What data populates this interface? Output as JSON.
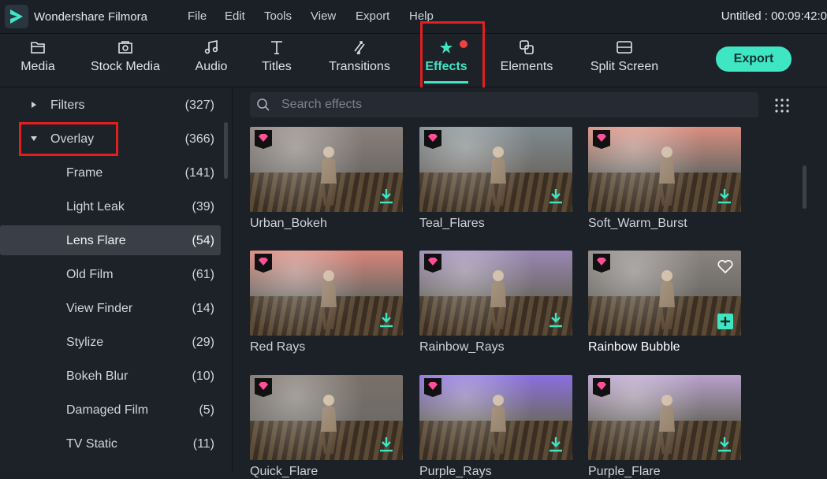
{
  "app": {
    "name": "Wondershare Filmora",
    "project_info": "Untitled : 00:09:42:0"
  },
  "menu": [
    "File",
    "Edit",
    "Tools",
    "View",
    "Export",
    "Help"
  ],
  "toolbar": {
    "tabs": [
      {
        "label": "Media",
        "icon": "folder-icon"
      },
      {
        "label": "Stock Media",
        "icon": "stock-media-icon"
      },
      {
        "label": "Audio",
        "icon": "music-note-icon"
      },
      {
        "label": "Titles",
        "icon": "text-t-icon"
      },
      {
        "label": "Transitions",
        "icon": "transitions-icon"
      },
      {
        "label": "Effects",
        "icon": "effects-star-icon",
        "active": true
      },
      {
        "label": "Elements",
        "icon": "elements-icon"
      },
      {
        "label": "Split Screen",
        "icon": "split-screen-icon"
      }
    ],
    "export_label": "Export",
    "accent_color": "#3ee6c4"
  },
  "sidebar": {
    "categories": [
      {
        "name": "Filters",
        "count": "(327)",
        "expanded": false
      },
      {
        "name": "Overlay",
        "count": "(366)",
        "expanded": true
      },
      {
        "name": "Frame",
        "count": "(141)"
      },
      {
        "name": "Light Leak",
        "count": "(39)"
      },
      {
        "name": "Lens Flare",
        "count": "(54)",
        "selected": true
      },
      {
        "name": "Old Film",
        "count": "(61)"
      },
      {
        "name": "View Finder",
        "count": "(14)"
      },
      {
        "name": "Stylize",
        "count": "(29)"
      },
      {
        "name": "Bokeh Blur",
        "count": "(10)"
      },
      {
        "name": "Damaged Film",
        "count": "(5)"
      },
      {
        "name": "TV Static",
        "count": "(11)"
      }
    ]
  },
  "search": {
    "placeholder": "Search effects"
  },
  "effects": [
    {
      "name": "Urban_Bokeh",
      "tint": "#8a7f7a"
    },
    {
      "name": "Teal_Flares",
      "tint": "#7e8a8e"
    },
    {
      "name": "Soft_Warm_Burst",
      "tint": "#d98d7e"
    },
    {
      "name": "Red Rays",
      "tint": "#d98478"
    },
    {
      "name": "Rainbow_Rays",
      "tint": "#9a86b4"
    },
    {
      "name": "Rainbow Bubble",
      "tint": "#8a8480"
    },
    {
      "name": "Quick_Flare",
      "tint": "#7a7068"
    },
    {
      "name": "Purple_Rays",
      "tint": "#8a6fe0"
    },
    {
      "name": "Purple_Flare",
      "tint": "#b8a0cc"
    }
  ]
}
